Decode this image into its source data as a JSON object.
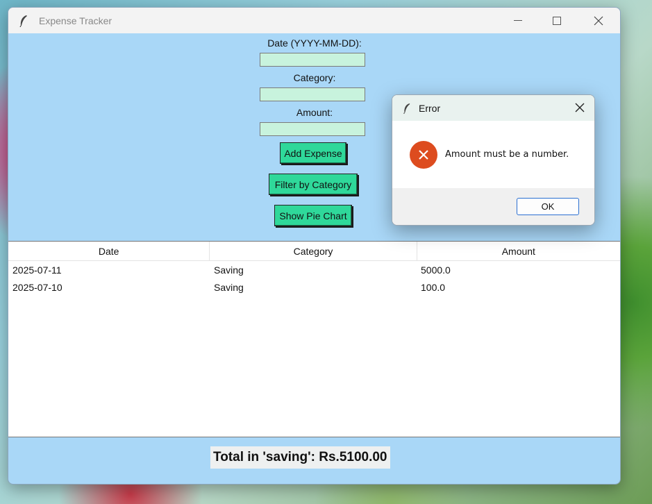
{
  "window": {
    "title": "Expense Tracker",
    "icon": "feather-icon"
  },
  "form": {
    "date_label": "Date (YYYY-MM-DD):",
    "date_value": "",
    "category_label": "Category:",
    "category_value": "",
    "amount_label": "Amount:",
    "amount_value": "",
    "add_button": "Add Expense",
    "filter_button": "Filter by Category",
    "pie_button": "Show Pie Chart"
  },
  "table": {
    "columns": [
      "Date",
      "Category",
      "Amount"
    ],
    "rows": [
      [
        "2025-07-11",
        "Saving",
        "5000.0"
      ],
      [
        "2025-07-10",
        "Saving",
        "100.0"
      ]
    ]
  },
  "total_text": "Total in 'saving': Rs.5100.00",
  "dialog": {
    "title": "Error",
    "message": "Amount must be a number.",
    "ok_label": "OK"
  },
  "colors": {
    "window_bg": "#a9d7f7",
    "entry_bg": "#c8f3dd",
    "button_bg": "#2fd89a",
    "error_icon": "#dd4c1f"
  }
}
